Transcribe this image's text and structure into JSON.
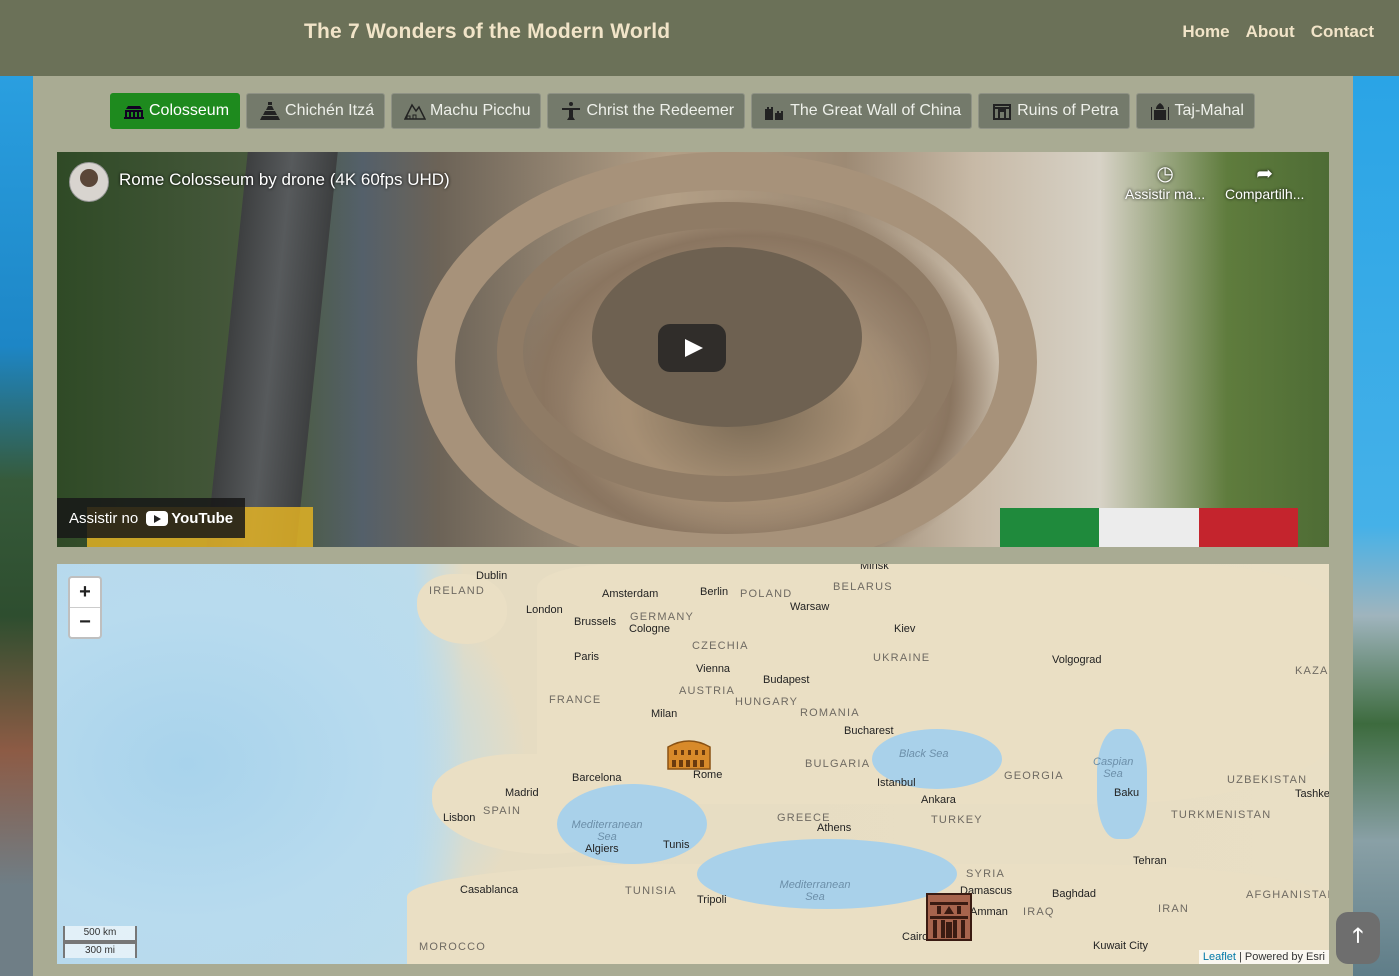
{
  "header": {
    "title": "The 7 Wonders of the Modern World",
    "nav": [
      "Home",
      "About",
      "Contact"
    ]
  },
  "tabs": [
    {
      "label": "Colosseum",
      "icon": "colosseum-icon",
      "active": true
    },
    {
      "label": "Chichén Itzá",
      "icon": "pyramid-icon",
      "active": false
    },
    {
      "label": "Machu Picchu",
      "icon": "mountain-ruins-icon",
      "active": false
    },
    {
      "label": "Christ the Redeemer",
      "icon": "statue-icon",
      "active": false
    },
    {
      "label": "The Great Wall of China",
      "icon": "great-wall-icon",
      "active": false
    },
    {
      "label": "Ruins of Petra",
      "icon": "petra-icon",
      "active": false
    },
    {
      "label": "Taj-Mahal",
      "icon": "taj-mahal-icon",
      "active": false
    }
  ],
  "video": {
    "title": "Rome Colosseum by drone (4K 60fps UHD)",
    "watch_later": "Assistir ma...",
    "share": "Compartilh...",
    "watch_on": "Assistir no",
    "youtube": "YouTube"
  },
  "map": {
    "zoom_in": "+",
    "zoom_out": "−",
    "scale_km": "500 km",
    "scale_mi": "300 mi",
    "attribution_link": "Leaflet",
    "attribution_text": " | Powered by Esri",
    "cities": [
      "Dublin",
      "London",
      "Amsterdam",
      "Berlin",
      "Warsaw",
      "Minsk",
      "Brussels",
      "Cologne",
      "Paris",
      "Kiev",
      "Volgograd",
      "Vienna",
      "Budapest",
      "Milan",
      "Bucharest",
      "Rome",
      "Barcelona",
      "Madrid",
      "Lisbon",
      "Istanbul",
      "Ankara",
      "Baku",
      "Athens",
      "Algiers",
      "Tunis",
      "Tehran",
      "Casablanca",
      "Tripoli",
      "Damascus",
      "Amman",
      "Baghdad",
      "Cairo",
      "Kuwait City",
      "Tashkent"
    ],
    "countries": [
      "IRELAND",
      "GERMANY",
      "POLAND",
      "BELARUS",
      "CZECHIA",
      "UKRAINE",
      "KAZA",
      "FRANCE",
      "AUSTRIA",
      "HUNGARY",
      "ROMANIA",
      "BULGARIA",
      "GEORGIA",
      "UZBEKISTAN",
      "SPAIN",
      "GREECE",
      "TURKEY",
      "TURKMENISTAN",
      "TUNISIA",
      "SYRIA",
      "IRAQ",
      "IRAN",
      "AFGHANISTAN",
      "MOROCCO"
    ],
    "waters": [
      "Black Sea",
      "Caspian Sea",
      "Mediterranean Sea",
      "Mediterranean Sea"
    ],
    "markers": [
      "colosseum-marker",
      "petra-marker"
    ]
  },
  "colors": {
    "header_bg": "#6b7158",
    "panel_bg": "#a9ab93",
    "active_tab": "#1e8a1e",
    "title_text": "#f1e4c8"
  }
}
